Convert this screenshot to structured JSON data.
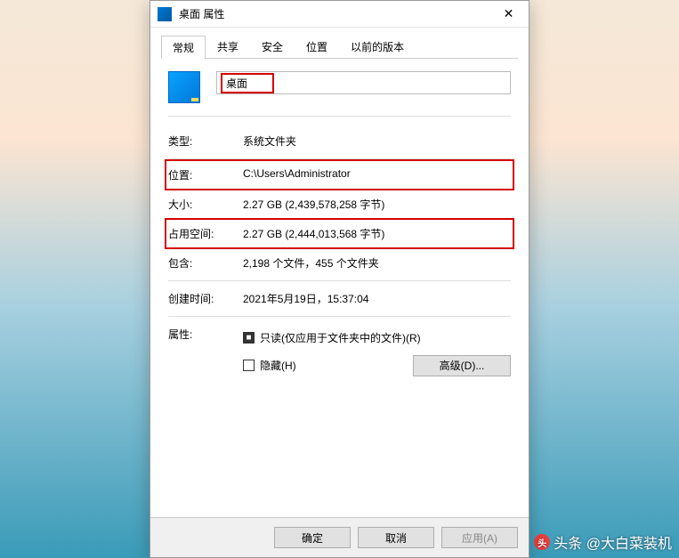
{
  "titlebar": {
    "title": "桌面 属性",
    "close_symbol": "✕"
  },
  "tabs": [
    {
      "label": "常规",
      "active": true
    },
    {
      "label": "共享",
      "active": false
    },
    {
      "label": "安全",
      "active": false
    },
    {
      "label": "位置",
      "active": false
    },
    {
      "label": "以前的版本",
      "active": false
    }
  ],
  "folder_name": "桌面",
  "rows": {
    "type_label": "类型:",
    "type_value": "系统文件夹",
    "location_label": "位置:",
    "location_value": "C:\\Users\\Administrator",
    "size_label": "大小:",
    "size_value": "2.27 GB (2,439,578,258 字节)",
    "disk_label": "占用空间:",
    "disk_value": "2.27 GB (2,444,013,568 字节)",
    "contains_label": "包含:",
    "contains_value": "2,198 个文件，455 个文件夹",
    "created_label": "创建时间:",
    "created_value": "2021年5月19日，15:37:04",
    "attr_label": "属性:"
  },
  "checkboxes": {
    "readonly_label": "只读(仅应用于文件夹中的文件)(R)",
    "hidden_label": "隐藏(H)"
  },
  "buttons": {
    "advanced": "高级(D)...",
    "ok": "确定",
    "cancel": "取消",
    "apply": "应用(A)"
  },
  "watermark": {
    "text": "头条 @大白菜装机"
  }
}
